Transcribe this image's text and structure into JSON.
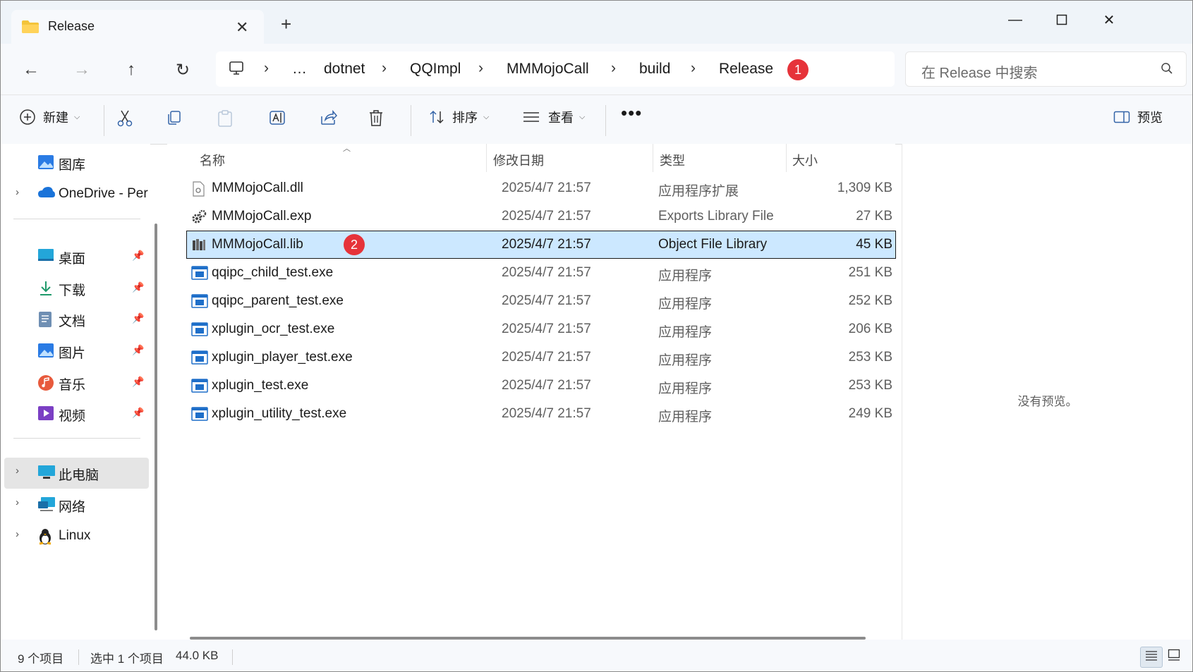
{
  "tab": {
    "title": "Release"
  },
  "address": {
    "crumbs": [
      "…",
      "dotnet",
      "QQImpl",
      "MMMojoCall",
      "build",
      "Release"
    ],
    "badge": "1"
  },
  "search": {
    "placeholder": "在 Release 中搜索"
  },
  "toolbar": {
    "new_label": "新建",
    "sort_label": "排序",
    "view_label": "查看",
    "preview_label": "预览"
  },
  "sidebar": {
    "items": [
      {
        "label": "图库"
      },
      {
        "label": "OneDrive - Per"
      },
      {
        "label": "桌面"
      },
      {
        "label": "下载"
      },
      {
        "label": "文档"
      },
      {
        "label": "图片"
      },
      {
        "label": "音乐"
      },
      {
        "label": "视频"
      },
      {
        "label": "此电脑"
      },
      {
        "label": "网络"
      },
      {
        "label": "Linux"
      }
    ]
  },
  "columns": {
    "name": "名称",
    "date": "修改日期",
    "type": "类型",
    "size": "大小"
  },
  "files": [
    {
      "name": "MMMojoCall.dll",
      "date": "2025/4/7 21:57",
      "type": "应用程序扩展",
      "size": "1,309 KB"
    },
    {
      "name": "MMMojoCall.exp",
      "date": "2025/4/7 21:57",
      "type": "Exports Library File",
      "size": "27 KB"
    },
    {
      "name": "MMMojoCall.lib",
      "date": "2025/4/7 21:57",
      "type": "Object File Library",
      "size": "45 KB"
    },
    {
      "name": "qqipc_child_test.exe",
      "date": "2025/4/7 21:57",
      "type": "应用程序",
      "size": "251 KB"
    },
    {
      "name": "qqipc_parent_test.exe",
      "date": "2025/4/7 21:57",
      "type": "应用程序",
      "size": "252 KB"
    },
    {
      "name": "xplugin_ocr_test.exe",
      "date": "2025/4/7 21:57",
      "type": "应用程序",
      "size": "206 KB"
    },
    {
      "name": "xplugin_player_test.exe",
      "date": "2025/4/7 21:57",
      "type": "应用程序",
      "size": "253 KB"
    },
    {
      "name": "xplugin_test.exe",
      "date": "2025/4/7 21:57",
      "type": "应用程序",
      "size": "253 KB"
    },
    {
      "name": "xplugin_utility_test.exe",
      "date": "2025/4/7 21:57",
      "type": "应用程序",
      "size": "249 KB"
    }
  ],
  "selected_badge": "2",
  "preview": {
    "text": "没有预览。"
  },
  "status": {
    "count": "9 个项目",
    "selection": "选中 1 个项目",
    "size": "44.0 KB"
  },
  "colors": {
    "selection": "#cce8ff",
    "badge": "#e6333a",
    "chrome": "#eff4f9"
  }
}
